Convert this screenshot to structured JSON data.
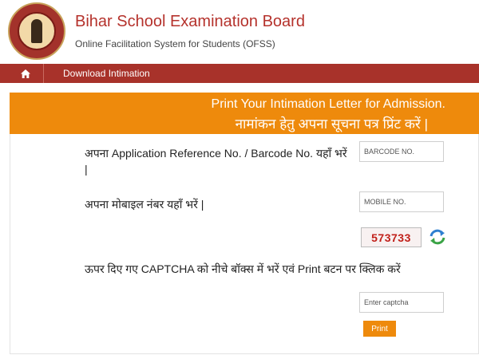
{
  "header": {
    "title": "Bihar School Examination Board",
    "subtitle": "Online Facilitation System for Students (OFSS)"
  },
  "nav": {
    "home_icon": "home-icon",
    "link": "Download Intimation"
  },
  "banner": {
    "line_en": "Print Your Intimation Letter for Admission.",
    "line_hi": "नामांकन हेतु अपना सूचना पत्र प्रिंट करें |"
  },
  "form": {
    "barcode_label": "अपना Application Reference No. / Barcode No. यहाँ भरें |",
    "barcode_placeholder": "BARCODE NO.",
    "mobile_label": "अपना मोबाइल नंबर यहाँ भरें |",
    "mobile_placeholder": "MOBILE NO.",
    "captcha_value": "573733",
    "captcha_instruction": "ऊपर दिए गए CAPTCHA को नीचे बॉक्स में भरें एवं Print बटन पर क्लिक करें",
    "captcha_placeholder": "Enter captcha",
    "print_label": "Print"
  },
  "colors": {
    "brand_red": "#a8322a",
    "accent_orange": "#ee8a0c",
    "captcha_red": "#c1201a"
  }
}
